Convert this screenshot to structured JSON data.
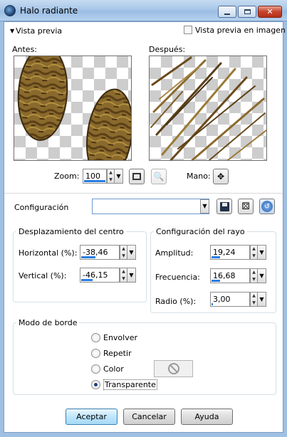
{
  "window": {
    "title": "Halo radiante"
  },
  "preview": {
    "toggle_label": "Vista previa",
    "image_preview_label": "Vista previa en imagen",
    "before_label": "Antes:",
    "after_label": "Después:",
    "zoom_label": "Zoom:",
    "zoom_value": "100",
    "hand_label": "Mano:"
  },
  "config": {
    "label": "Configuración",
    "value": ""
  },
  "center": {
    "title": "Desplazamiento del centro",
    "horizontal_label": "Horizontal (%):",
    "horizontal_value": "-38,46",
    "vertical_label": "Vertical (%):",
    "vertical_value": "-46,15"
  },
  "ray": {
    "title": "Configuración del rayo",
    "amplitude_label": "Amplitud:",
    "amplitude_value": "19,24",
    "frequency_label": "Frecuencia:",
    "frequency_value": "16,68",
    "radius_label": "Radio (%):",
    "radius_value": "3,00"
  },
  "edge": {
    "title": "Modo de borde",
    "options": [
      "Envolver",
      "Repetir",
      "Color",
      "Transparente"
    ],
    "selected": "Transparente"
  },
  "buttons": {
    "accept": "Aceptar",
    "cancel": "Cancelar",
    "help": "Ayuda"
  }
}
